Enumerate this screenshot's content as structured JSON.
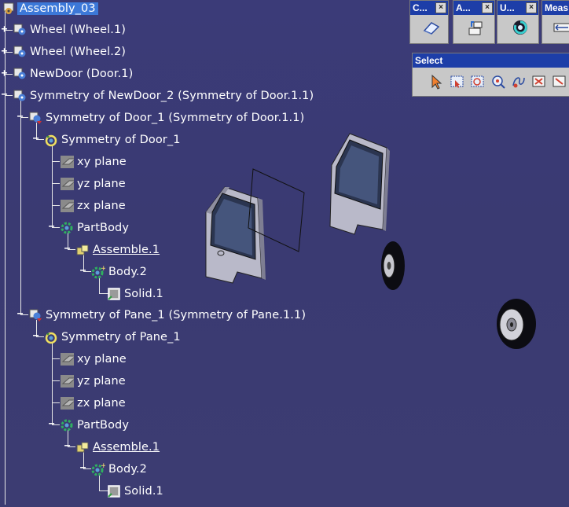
{
  "tree": {
    "root": "Assembly_03",
    "items": [
      {
        "label": "Wheel (Wheel.1)"
      },
      {
        "label": "Wheel (Wheel.2)"
      },
      {
        "label": "NewDoor (Door.1)"
      },
      {
        "label": "Symmetry of NewDoor_2 (Symmetry of Door.1.1)"
      },
      {
        "label": "Symmetry of Door_1 (Symmetry of Door.1.1)"
      },
      {
        "label": "Symmetry of Door_1"
      },
      {
        "label": "xy plane"
      },
      {
        "label": "yz plane"
      },
      {
        "label": "zx plane"
      },
      {
        "label": "PartBody"
      },
      {
        "label": "Assemble.1"
      },
      {
        "label": "Body.2"
      },
      {
        "label": "Solid.1"
      },
      {
        "label": "Symmetry of Pane_1 (Symmetry of Pane.1.1)"
      },
      {
        "label": "Symmetry of Pane_1"
      },
      {
        "label": "xy plane"
      },
      {
        "label": "yz plane"
      },
      {
        "label": "zx plane"
      },
      {
        "label": "PartBody"
      },
      {
        "label": "Assemble.1"
      },
      {
        "label": "Body.2"
      },
      {
        "label": "Solid.1"
      }
    ]
  },
  "toolbars": {
    "small": [
      {
        "title": "C...",
        "close": "×",
        "icon": "eraser-icon"
      },
      {
        "title": "A...",
        "close": "×",
        "icon": "manipulate-icon"
      },
      {
        "title": "U...",
        "close": "×",
        "icon": "update-icon"
      },
      {
        "title": "Meas",
        "icon": "measure-icon"
      }
    ],
    "select": {
      "title": "Select",
      "icons": [
        "select-arrow-icon",
        "select-trap-icon",
        "intersect-trap-icon",
        "polygon-trap-icon",
        "free-hand-trap-icon",
        "outside-trap-icon"
      ]
    }
  },
  "colors": {
    "background": "#3a3a74",
    "selection": "#3c78d8",
    "panel_title": "#1d3ea8"
  }
}
